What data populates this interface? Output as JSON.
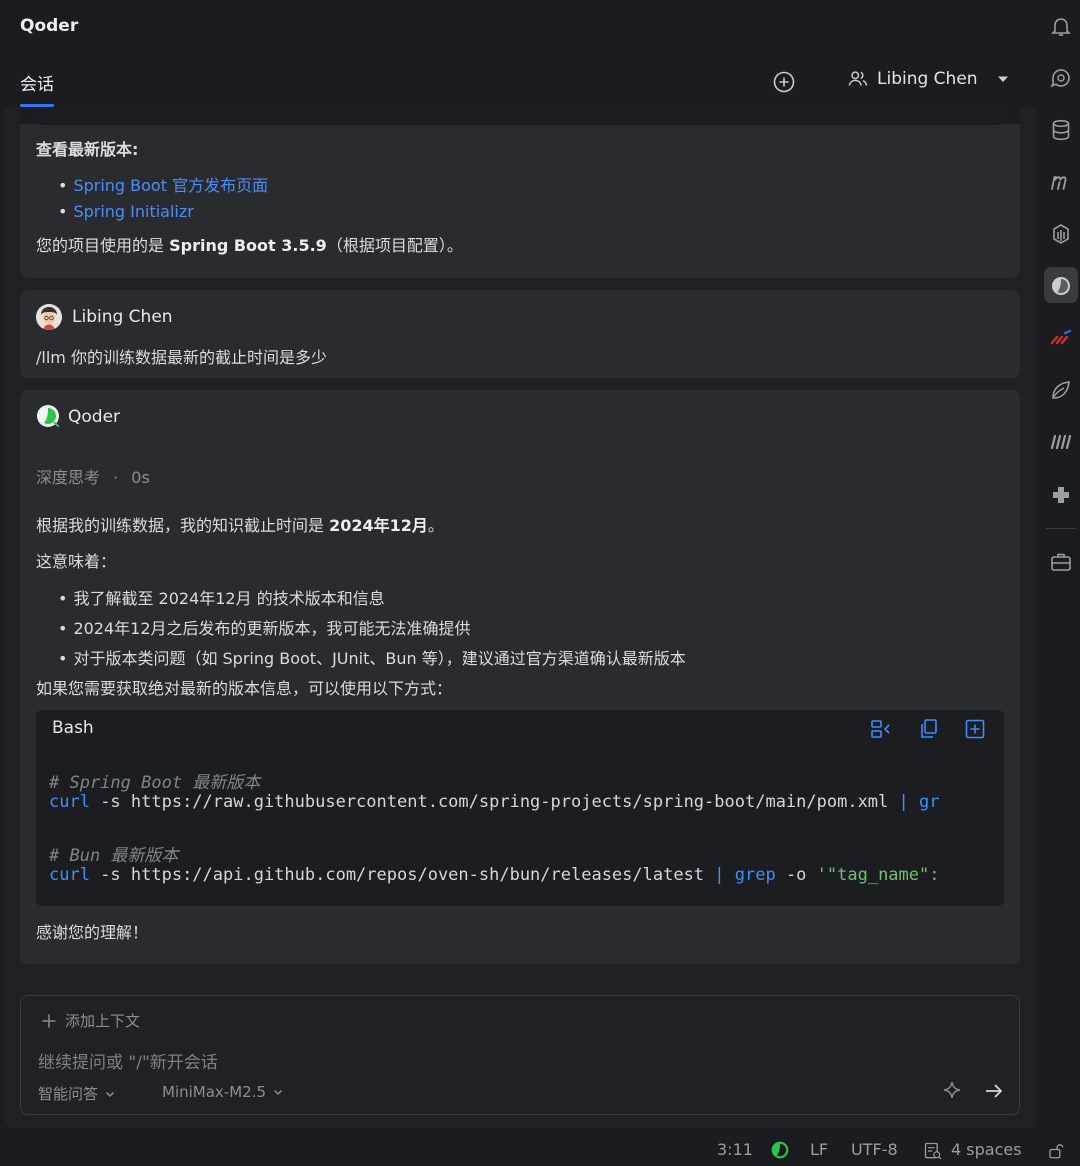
{
  "header": {
    "app_title": "Qoder",
    "tab_label": "会话",
    "user_name": "Libing Chen"
  },
  "prev_message": {
    "heading": "查看最新版本:",
    "links": [
      "Spring Boot 官方发布页面",
      "Spring Initializr"
    ],
    "summary_prefix": "您的项目使用的是 ",
    "summary_bold": "Spring Boot 3.5.9",
    "summary_suffix": "（根据项目配置）。"
  },
  "user_message": {
    "name": "Libing Chen",
    "text": "/llm 你的训练数据最新的截止时间是多少"
  },
  "reply": {
    "name": "Qoder",
    "thinking_label": "深度思考",
    "thinking_sep": "·",
    "thinking_time": "0s",
    "line1_prefix": "根据我的训练数据，我的知识截止时间是 ",
    "line1_bold": "2024年12月",
    "line1_suffix": "。",
    "line2": "这意味着：",
    "bullets": [
      "我了解截至 2024年12月 的技术版本和信息",
      "2024年12月之后发布的更新版本，我可能无法准确提供",
      "对于版本类问题（如 Spring Boot、JUnit、Bun 等），建议通过官方渠道确认最新版本"
    ],
    "line3": "如果您需要获取绝对最新的版本信息，可以使用以下方式：",
    "thanks": "感谢您的理解！"
  },
  "code": {
    "lang": "Bash",
    "comment1": "# Spring Boot 最新版本",
    "l1_cmd": "curl",
    "l1_args": " -s https://raw.githubusercontent.com/spring-projects/spring-boot/main/pom.xml ",
    "l1_pipe": "| gr",
    "comment2": "# Bun 最新版本",
    "l2_cmd": "curl",
    "l2_args": " -s https://api.github.com/repos/oven-sh/bun/releases/latest ",
    "l2_pipe": "| grep",
    "l2_flag": " -o ",
    "l2_str": "'\"tag_name\":"
  },
  "composer": {
    "add_context": "添加上下文",
    "placeholder": "继续提问或 \"/\"新开会话",
    "mode": "智能问答",
    "model": "MiniMax-M2.5"
  },
  "status": {
    "position": "3:11",
    "line_ending": "LF",
    "encoding": "UTF-8",
    "indent": "4 spaces"
  },
  "colors": {
    "accent": "#3574f0",
    "link": "#4c8cf5",
    "code_string": "#6fbf73"
  }
}
